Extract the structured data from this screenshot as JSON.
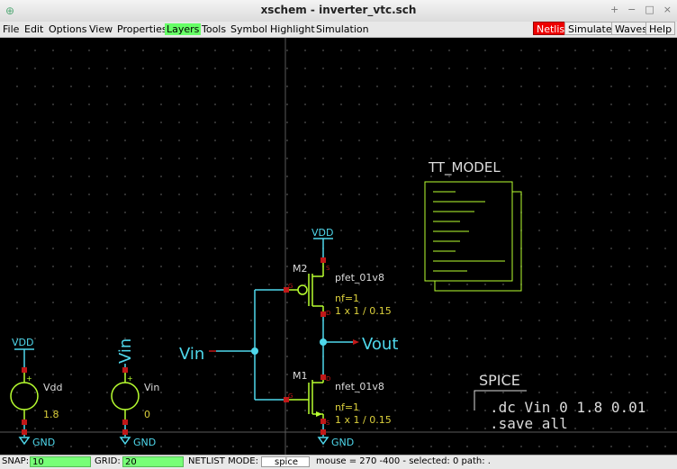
{
  "window": {
    "title": "xschem - inverter_vtc.sch",
    "controls": [
      "+",
      "−",
      "□",
      "×"
    ]
  },
  "menu": {
    "items": [
      "File",
      "Edit",
      "Options",
      "View",
      "Properties",
      "Layers",
      "Tools",
      "Symbol",
      "Highlight",
      "Simulation"
    ],
    "right": [
      "Netlist",
      "Simulate",
      "Waves",
      "Help"
    ]
  },
  "schematic": {
    "tt_model_label": "TT_MODEL",
    "vdd_top": "VDD",
    "m2_name": "M2",
    "m2_model": "pfet_01v8",
    "m2_nf": "nf=1",
    "m2_size": "1 x 1 / 0.15",
    "m1_name": "M1",
    "m1_model": "nfet_01v8",
    "m1_nf": "nf=1",
    "m1_size": "1 x 1 / 0.15",
    "pin_g": "G",
    "pin_d": "D",
    "pin_s": "S",
    "vin_label": "Vin",
    "vout_label": "Vout",
    "gnd": "GND",
    "vdd_src_rail": "VDD",
    "vdd_src_name": "Vdd",
    "vdd_src_value": "1.8",
    "vin_src_rail": "Vin",
    "vin_src_name": "Vin",
    "vin_src_value": "0",
    "plus": "+",
    "spice_title": "SPICE",
    "spice_line1": ".dc Vin 0 1.8 0.01",
    "spice_line2": ".save all"
  },
  "status": {
    "snap_label": "SNAP:",
    "snap_value": "10",
    "grid_label": "GRID:",
    "grid_value": "20",
    "netlist_mode_label": "NETLIST MODE:",
    "netlist_mode_value": "spice",
    "info": "mouse = 270 -400 - selected: 0 path: ."
  },
  "colors": {
    "wire": "#4fd8ec",
    "symbol": "#b8ff30",
    "pin": "#c01818",
    "label": "#dcdcdc",
    "prop": "#dcd03c",
    "netlist_button": "#e00000",
    "layers_highlight": "#66ff66"
  }
}
